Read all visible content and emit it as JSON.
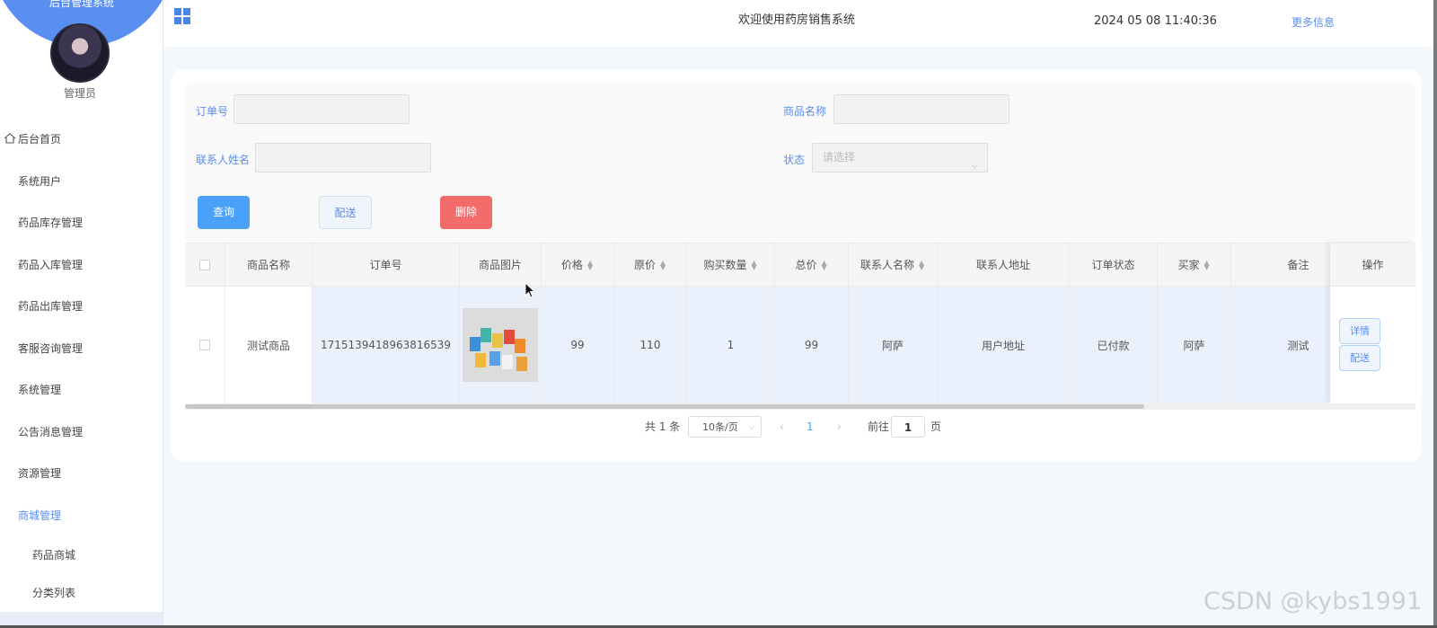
{
  "sidebar": {
    "system_name": "后台管理系统",
    "user_role": "管理员",
    "menu": [
      {
        "label": "后台首页",
        "icon": "home-icon"
      },
      {
        "label": "系统用户"
      },
      {
        "label": "药品库存管理"
      },
      {
        "label": "药品入库管理"
      },
      {
        "label": "药品出库管理"
      },
      {
        "label": "客服咨询管理"
      },
      {
        "label": "系统管理"
      },
      {
        "label": "公告消息管理"
      },
      {
        "label": "资源管理"
      },
      {
        "label": "商城管理",
        "active": true
      }
    ],
    "submenu": [
      {
        "label": "药品商城"
      },
      {
        "label": "分类列表"
      }
    ]
  },
  "header": {
    "title": "欢迎使用药房销售系统",
    "datetime": "2024 05 08 11:40:36",
    "more_info": "更多信息"
  },
  "filters": {
    "order_no_label": "订单号",
    "product_name_label": "商品名称",
    "contact_name_label": "联系人姓名",
    "status_label": "状态",
    "status_placeholder": "请选择"
  },
  "buttons": {
    "query": "查询",
    "ship": "配送",
    "delete": "删除"
  },
  "table": {
    "columns": [
      "商品名称",
      "订单号",
      "商品图片",
      "价格",
      "原价",
      "购买数量",
      "总价",
      "联系人名称",
      "联系人地址",
      "订单状态",
      "买家",
      "备注",
      "操作"
    ],
    "rows": [
      {
        "product_name": "测试商品",
        "order_no": "1715139418963816539",
        "price": "99",
        "original_price": "110",
        "quantity": "1",
        "total": "99",
        "contact_name": "阿萨",
        "contact_address": "用户地址",
        "status": "已付款",
        "buyer": "阿萨",
        "remark": "测试",
        "actions": [
          "详情",
          "配送"
        ]
      }
    ]
  },
  "pagination": {
    "total": "共 1 条",
    "page_size": "10条/页",
    "current_page": "1",
    "goto_label": "前往",
    "goto_value": "1",
    "page_unit": "页"
  },
  "watermark": "CSDN @kybs1991",
  "colors": {
    "accent": "#5b8ef0",
    "query_button": "#4ba0f8",
    "delete_button": "#f46b6b",
    "sidebar_header": "#5a8ff2"
  }
}
